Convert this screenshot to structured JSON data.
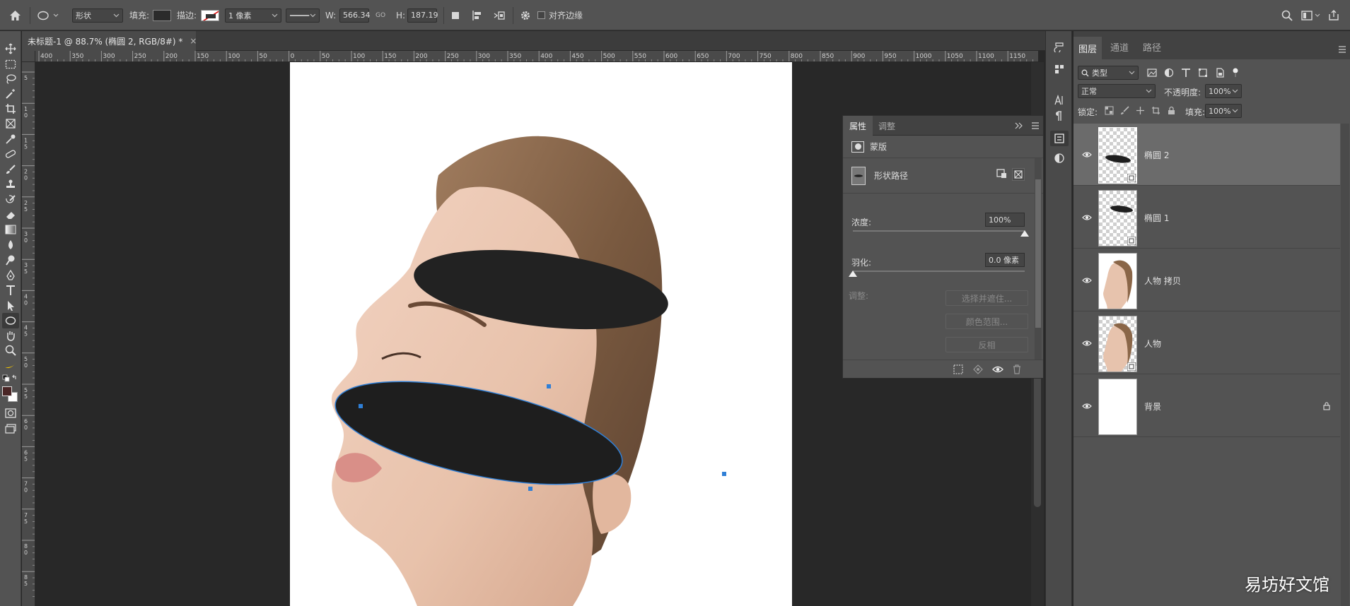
{
  "options_bar": {
    "shape_mode": "形状",
    "fill_label": "填充:",
    "stroke_label": "描边:",
    "stroke_width": "1 像素",
    "w_label": "W:",
    "w_value": "566.34",
    "link_label": "GO",
    "h_label": "H:",
    "h_value": "187.19",
    "align_edges": "对齐边缘"
  },
  "document_tab": {
    "title": "未标题-1 @ 88.7% (椭圆 2, RGB/8#) *",
    "close": "×"
  },
  "ruler": {
    "top_labels": [
      "400",
      "350",
      "300",
      "250",
      "200",
      "150",
      "100",
      "50",
      "0",
      "50",
      "100",
      "150",
      "200",
      "250",
      "300",
      "350",
      "400",
      "450",
      "500",
      "550",
      "600",
      "650",
      "700",
      "750",
      "800",
      "850",
      "900",
      "950",
      "1000",
      "1050",
      "1100",
      "1150"
    ],
    "left_labels": [
      "5",
      "1 0",
      "1 5",
      "2 0",
      "2 5",
      "3 0",
      "3 5",
      "4 0",
      "4 5",
      "5 0",
      "5 5",
      "6 0",
      "6 5",
      "7 0",
      "7 5",
      "8 0",
      "8 5"
    ]
  },
  "properties_panel": {
    "tab_properties": "属性",
    "tab_adjustments": "调整",
    "mask_label": "蒙版",
    "shape_path_label": "形状路径",
    "density_label": "浓度:",
    "density_value": "100%",
    "feather_label": "羽化:",
    "feather_value": "0.0 像素",
    "refine_label": "调整:",
    "btn_select_mask": "选择并遮住...",
    "btn_color_range": "颜色范围...",
    "btn_invert": "反相"
  },
  "layers_panel": {
    "tab_layers": "图层",
    "tab_channels": "通道",
    "tab_paths": "路径",
    "filter_kind": "类型",
    "blend_mode": "正常",
    "opacity_label": "不透明度:",
    "opacity_value": "100%",
    "lock_label": "锁定:",
    "fill_label": "填充:",
    "fill_value": "100%",
    "layers": [
      {
        "name": "椭圆 2",
        "selected": true
      },
      {
        "name": "椭圆 1",
        "selected": false
      },
      {
        "name": "人物 拷贝",
        "selected": false
      },
      {
        "name": "人物",
        "selected": false
      },
      {
        "name": "背景",
        "selected": false
      }
    ]
  },
  "watermark": "易坊好文馆",
  "colors": {
    "panel": "#535353",
    "canvas_bg": "#282828",
    "path_blue": "#2f7fd6",
    "ellipse_fill": "#1e1e1e"
  }
}
